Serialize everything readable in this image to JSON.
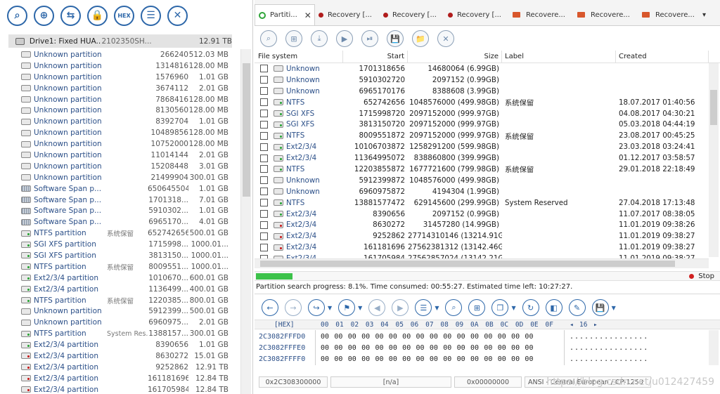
{
  "left_toolbar": {
    "buttons": [
      {
        "name": "search-button",
        "glyph": "⌕"
      },
      {
        "name": "scan-disk-button",
        "glyph": "⊕"
      },
      {
        "name": "open-disk-button",
        "glyph": "⇆"
      },
      {
        "name": "lock-button",
        "glyph": "🔒"
      },
      {
        "name": "hex-view-button",
        "glyph": "HEX"
      },
      {
        "name": "list-view-button",
        "glyph": "☰"
      },
      {
        "name": "close-button",
        "glyph": "✕"
      }
    ]
  },
  "drive": {
    "name": "Drive1: Fixed HUA...",
    "id": "2102350SH...",
    "size": "12.91 TB"
  },
  "tree": [
    {
      "icon": "plain",
      "name": "Unknown partition",
      "label": "",
      "start": "266240",
      "size": "512.03 MB"
    },
    {
      "icon": "plain",
      "name": "Unknown partition",
      "label": "",
      "start": "1314816",
      "size": "128.00 MB"
    },
    {
      "icon": "plain",
      "name": "Unknown partition",
      "label": "",
      "start": "1576960",
      "size": "1.01 GB"
    },
    {
      "icon": "plain",
      "name": "Unknown partition",
      "label": "",
      "start": "3674112",
      "size": "2.01 GB"
    },
    {
      "icon": "plain",
      "name": "Unknown partition",
      "label": "",
      "start": "7868416",
      "size": "128.00 MB"
    },
    {
      "icon": "plain",
      "name": "Unknown partition",
      "label": "",
      "start": "8130560",
      "size": "128.00 MB"
    },
    {
      "icon": "plain",
      "name": "Unknown partition",
      "label": "",
      "start": "8392704",
      "size": "1.01 GB"
    },
    {
      "icon": "plain",
      "name": "Unknown partition",
      "label": "",
      "start": "10489856",
      "size": "128.00 MB"
    },
    {
      "icon": "plain",
      "name": "Unknown partition",
      "label": "",
      "start": "10752000",
      "size": "128.00 MB"
    },
    {
      "icon": "plain",
      "name": "Unknown partition",
      "label": "",
      "start": "11014144",
      "size": "2.01 GB"
    },
    {
      "icon": "plain",
      "name": "Unknown partition",
      "label": "",
      "start": "15208448",
      "size": "3.01 GB"
    },
    {
      "icon": "plain",
      "name": "Unknown partition",
      "label": "",
      "start": "21499904",
      "size": "300.01 GB"
    },
    {
      "icon": "span",
      "name": "Software Span p...",
      "label": "",
      "start": "650645504",
      "size": "1.01 GB"
    },
    {
      "icon": "span",
      "name": "Software Span p...",
      "label": "",
      "start": "1701318...",
      "size": "7.01 GB"
    },
    {
      "icon": "span",
      "name": "Software Span p...",
      "label": "",
      "start": "5910302...",
      "size": "1.01 GB"
    },
    {
      "icon": "span",
      "name": "Software Span p...",
      "label": "",
      "start": "6965170...",
      "size": "4.01 GB"
    },
    {
      "icon": "green",
      "name": "NTFS partition",
      "label": "系统保留",
      "start": "652742656",
      "size": "500.01 GB"
    },
    {
      "icon": "green",
      "name": "SGI XFS partition",
      "label": "",
      "start": "1715998...",
      "size": "1000.01..."
    },
    {
      "icon": "green",
      "name": "SGI XFS partition",
      "label": "",
      "start": "3813150...",
      "size": "1000.01..."
    },
    {
      "icon": "green",
      "name": "NTFS partition",
      "label": "系统保留",
      "start": "8009551...",
      "size": "1000.01..."
    },
    {
      "icon": "green",
      "name": "Ext2/3/4 partition",
      "label": "",
      "start": "1010670...",
      "size": "600.01 GB"
    },
    {
      "icon": "green",
      "name": "Ext2/3/4 partition",
      "label": "",
      "start": "1136499...",
      "size": "400.01 GB"
    },
    {
      "icon": "green",
      "name": "NTFS partition",
      "label": "系统保留",
      "start": "1220385...",
      "size": "800.01 GB"
    },
    {
      "icon": "plain",
      "name": "Unknown partition",
      "label": "",
      "start": "5912399...",
      "size": "500.01 GB"
    },
    {
      "icon": "plain",
      "name": "Unknown partition",
      "label": "",
      "start": "6960975...",
      "size": "2.01 GB"
    },
    {
      "icon": "green",
      "name": "NTFS partition",
      "label": "System Res...",
      "start": "1388157...",
      "size": "300.01 GB"
    },
    {
      "icon": "green",
      "name": "Ext2/3/4 partition",
      "label": "",
      "start": "8390656",
      "size": "1.01 GB"
    },
    {
      "icon": "red",
      "name": "Ext2/3/4 partition",
      "label": "",
      "start": "8630272",
      "size": "15.01 GB"
    },
    {
      "icon": "red",
      "name": "Ext2/3/4 partition",
      "label": "",
      "start": "9252862",
      "size": "12.91 TB"
    },
    {
      "icon": "red",
      "name": "Ext2/3/4 partition",
      "label": "",
      "start": "161181696",
      "size": "12.84 TB"
    },
    {
      "icon": "red",
      "name": "Ext2/3/4 partition",
      "label": "",
      "start": "161705984",
      "size": "12.84 TB"
    }
  ],
  "tabs": [
    {
      "kind": "donut",
      "label": "Partiti...",
      "active": true,
      "close": "✕"
    },
    {
      "kind": "dot",
      "label": "Recovery [..."
    },
    {
      "kind": "dot",
      "label": "Recovery [..."
    },
    {
      "kind": "dot",
      "label": "Recovery [..."
    },
    {
      "kind": "folder",
      "label": "Recovere..."
    },
    {
      "kind": "folder",
      "label": "Recovere..."
    },
    {
      "kind": "folder",
      "label": "Recovere..."
    }
  ],
  "tabs_overflow": "▾",
  "result_toolbar": [
    "⌕",
    "⊞",
    "⤓",
    "▶",
    "⏯",
    "💾",
    "📁",
    "✕"
  ],
  "table": {
    "headers": [
      "File system",
      "Start",
      "Size",
      "Label",
      "Created"
    ],
    "rows": [
      {
        "icon": "plain",
        "fs": "Unknown",
        "start": "1701318656",
        "size": "14680064 (6.99GB)",
        "label": "",
        "created": ""
      },
      {
        "icon": "plain",
        "fs": "Unknown",
        "start": "5910302720",
        "size": "2097152 (0.99GB)",
        "label": "",
        "created": ""
      },
      {
        "icon": "plain",
        "fs": "Unknown",
        "start": "6965170176",
        "size": "8388608 (3.99GB)",
        "label": "",
        "created": ""
      },
      {
        "icon": "green",
        "fs": "NTFS",
        "start": "652742656",
        "size": "1048576000 (499.98GB)",
        "label": "系统保留",
        "created": "18.07.2017 01:40:56"
      },
      {
        "icon": "green",
        "fs": "SGI XFS",
        "start": "1715998720",
        "size": "2097152000 (999.97GB)",
        "label": "",
        "created": "04.08.2017 04:30:21"
      },
      {
        "icon": "green",
        "fs": "SGI XFS",
        "start": "3813150720",
        "size": "2097152000 (999.97GB)",
        "label": "",
        "created": "05.03.2018 04:44:19"
      },
      {
        "icon": "green",
        "fs": "NTFS",
        "start": "8009551872",
        "size": "2097152000 (999.97GB)",
        "label": "系统保留",
        "created": "23.08.2017 00:45:25"
      },
      {
        "icon": "green",
        "fs": "Ext2/3/4",
        "start": "10106703872",
        "size": "1258291200 (599.98GB)",
        "label": "",
        "created": "23.03.2018 03:24:41"
      },
      {
        "icon": "green",
        "fs": "Ext2/3/4",
        "start": "11364995072",
        "size": "838860800 (399.99GB)",
        "label": "",
        "created": "01.12.2017 03:58:57"
      },
      {
        "icon": "green",
        "fs": "NTFS",
        "start": "12203855872",
        "size": "1677721600 (799.98GB)",
        "label": "系统保留",
        "created": "29.01.2018 22:18:49"
      },
      {
        "icon": "plain",
        "fs": "Unknown",
        "start": "5912399872",
        "size": "1048576000 (499.98GB)",
        "label": "",
        "created": ""
      },
      {
        "icon": "plain",
        "fs": "Unknown",
        "start": "6960975872",
        "size": "4194304 (1.99GB)",
        "label": "",
        "created": ""
      },
      {
        "icon": "green",
        "fs": "NTFS",
        "start": "13881577472",
        "size": "629145600 (299.99GB)",
        "label": "System Reserved",
        "created": "27.04.2018 17:13:48"
      },
      {
        "icon": "green",
        "fs": "Ext2/3/4",
        "start": "8390656",
        "size": "2097152 (0.99GB)",
        "label": "",
        "created": "11.07.2017 08:38:05"
      },
      {
        "icon": "red",
        "fs": "Ext2/3/4",
        "start": "8630272",
        "size": "31457280 (14.99GB)",
        "label": "",
        "created": "11.01.2019 09:38:26"
      },
      {
        "icon": "red",
        "fs": "Ext2/3/4",
        "start": "9252862",
        "size": "27714310146 (13214.91GB)",
        "label": "",
        "created": "11.01.2019 09:38:27"
      },
      {
        "icon": "red",
        "fs": "Ext2/3/4",
        "start": "161181696",
        "size": "27562381312 (13142.46GB)",
        "label": "",
        "created": "11.01.2019 09:38:27"
      },
      {
        "icon": "red",
        "fs": "Ext2/3/4",
        "start": "161705984",
        "size": "27562857024 (13142.21GB)",
        "label": "",
        "created": "11.01.2019 09:38:27"
      }
    ]
  },
  "progress": {
    "value": 0.081,
    "stop_label": "Stop",
    "text": "Partition search progress: 8.1%. Time consumed: 00:55:27. Estimated time left: 10:27:27."
  },
  "hex_toolbar": [
    "←",
    "→",
    "↪",
    "⚑",
    "◀",
    "▶",
    "☰",
    "⌕",
    "⊞",
    "❐",
    "↻",
    "◧",
    "✎",
    "💾"
  ],
  "hex": {
    "header_label": "[HEX]",
    "columns": [
      "00",
      "01",
      "02",
      "03",
      "04",
      "05",
      "06",
      "07",
      "08",
      "09",
      "0A",
      "0B",
      "0C",
      "0D",
      "0E",
      "0F"
    ],
    "bytes_per_row": "16",
    "rows": [
      {
        "offset": "2C3082FFFD0",
        "bytes": "00 00 00 00 00 00 00 00 00 00 00 00 00 00 00 00",
        "ascii": "................"
      },
      {
        "offset": "2C3082FFFE0",
        "bytes": "00 00 00 00 00 00 00 00 00 00 00 00 00 00 00 00",
        "ascii": "................"
      },
      {
        "offset": "2C3082FFFF0",
        "bytes": "00 00 00 00 00 00 00 00 00 00 00 00 00 00 00 00",
        "ascii": "................"
      }
    ]
  },
  "status": {
    "offset": "0x2C308300000",
    "value": "[n/a]",
    "pos": "0x00000000",
    "encoding": "ANSI - Central European / CP-1250"
  },
  "watermark": "https://blog.csdn.net/u012427459"
}
